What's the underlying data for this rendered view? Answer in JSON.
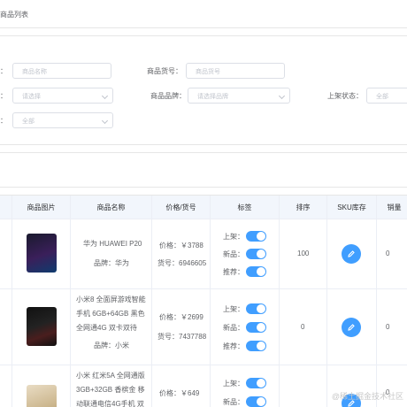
{
  "breadcrumb": {
    "current": "商品列表"
  },
  "filters": {
    "name": {
      "label": "：",
      "placeholder": "商品名称"
    },
    "sn": {
      "label": "商品货号：",
      "placeholder": "商品货号"
    },
    "category": {
      "label": "：",
      "placeholder": "请选择"
    },
    "brand": {
      "label": "商品品牌：",
      "placeholder": "请选择品牌"
    },
    "publish": {
      "label": "上架状态：",
      "placeholder": "全部"
    },
    "verify": {
      "label": "：",
      "placeholder": "全部"
    }
  },
  "table": {
    "headers": [
      "商品图片",
      "商品名称",
      "价格/货号",
      "标签",
      "排序",
      "SKU库存",
      "销量"
    ],
    "rows": [
      {
        "name_lines": [
          "华为 HUAWEI P20"
        ],
        "brand": "品牌：华为",
        "price": "价格：￥3788",
        "sn": "货号：6946605",
        "labels": [
          "上架：",
          "新品：",
          "推荐："
        ],
        "sort": "100",
        "sales": "0",
        "image_icon": "phone-image"
      },
      {
        "name_lines": [
          "小米8 全面屏游戏智能",
          "手机 6GB+64GB 黑色",
          "全网通4G 双卡双待"
        ],
        "brand": "品牌：小米",
        "price": "价格：￥2699",
        "sn": "货号：7437788",
        "labels": [
          "上架：",
          "新品：",
          "推荐："
        ],
        "sort": "0",
        "sales": "0",
        "image_icon": "phone-image"
      },
      {
        "name_lines": [
          "小米 红米5A 全网通版",
          "3GB+32GB 香槟金 移",
          "动联通电信4G手机 双"
        ],
        "brand": "",
        "price": "价格：￥649",
        "sn": "",
        "labels": [
          "上架：",
          "新品："
        ],
        "sort": "",
        "sales": "0",
        "image_icon": "phone-image"
      }
    ]
  },
  "watermark": "@稀土掘金技术社区",
  "colors": {
    "primary": "#409eff",
    "border": "#ebeef5",
    "header_bg": "#f2f6fc"
  }
}
